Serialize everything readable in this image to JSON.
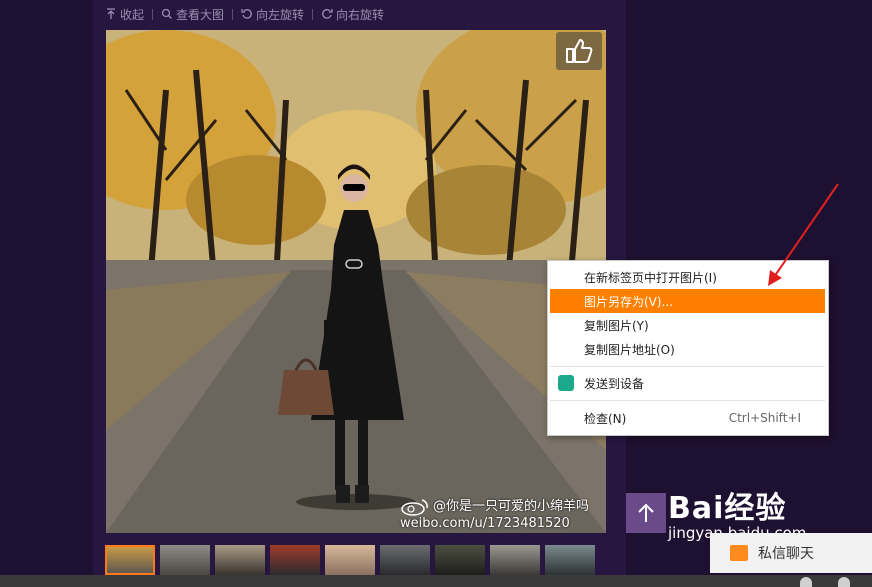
{
  "toolbar": {
    "collapse": "收起",
    "view_large": "查看大图",
    "rotate_left": "向左旋转",
    "rotate_right": "向右旋转"
  },
  "photo": {
    "watermark_line1": "@你是一只可爱的小绵羊吗",
    "watermark_line2": "weibo.com/u/1723481520"
  },
  "context_menu": {
    "items": [
      {
        "label": "在新标签页中打开图片(I)"
      },
      {
        "label": "图片另存为(V)..."
      },
      {
        "label": "复制图片(Y)"
      },
      {
        "label": "复制图片地址(O)"
      },
      {
        "label": "发送到设备"
      },
      {
        "label": "检查(N)",
        "shortcut": "Ctrl+Shift+I"
      }
    ],
    "highlight_color": "#ff8000"
  },
  "chat": {
    "label": "私信聊天"
  },
  "baidu": {
    "logo": "Bai经验",
    "sub": "jingyan.baidu.com"
  },
  "colors": {
    "background": "#1e1030",
    "panel": "#261640",
    "accent_arrow": "#e02020"
  }
}
